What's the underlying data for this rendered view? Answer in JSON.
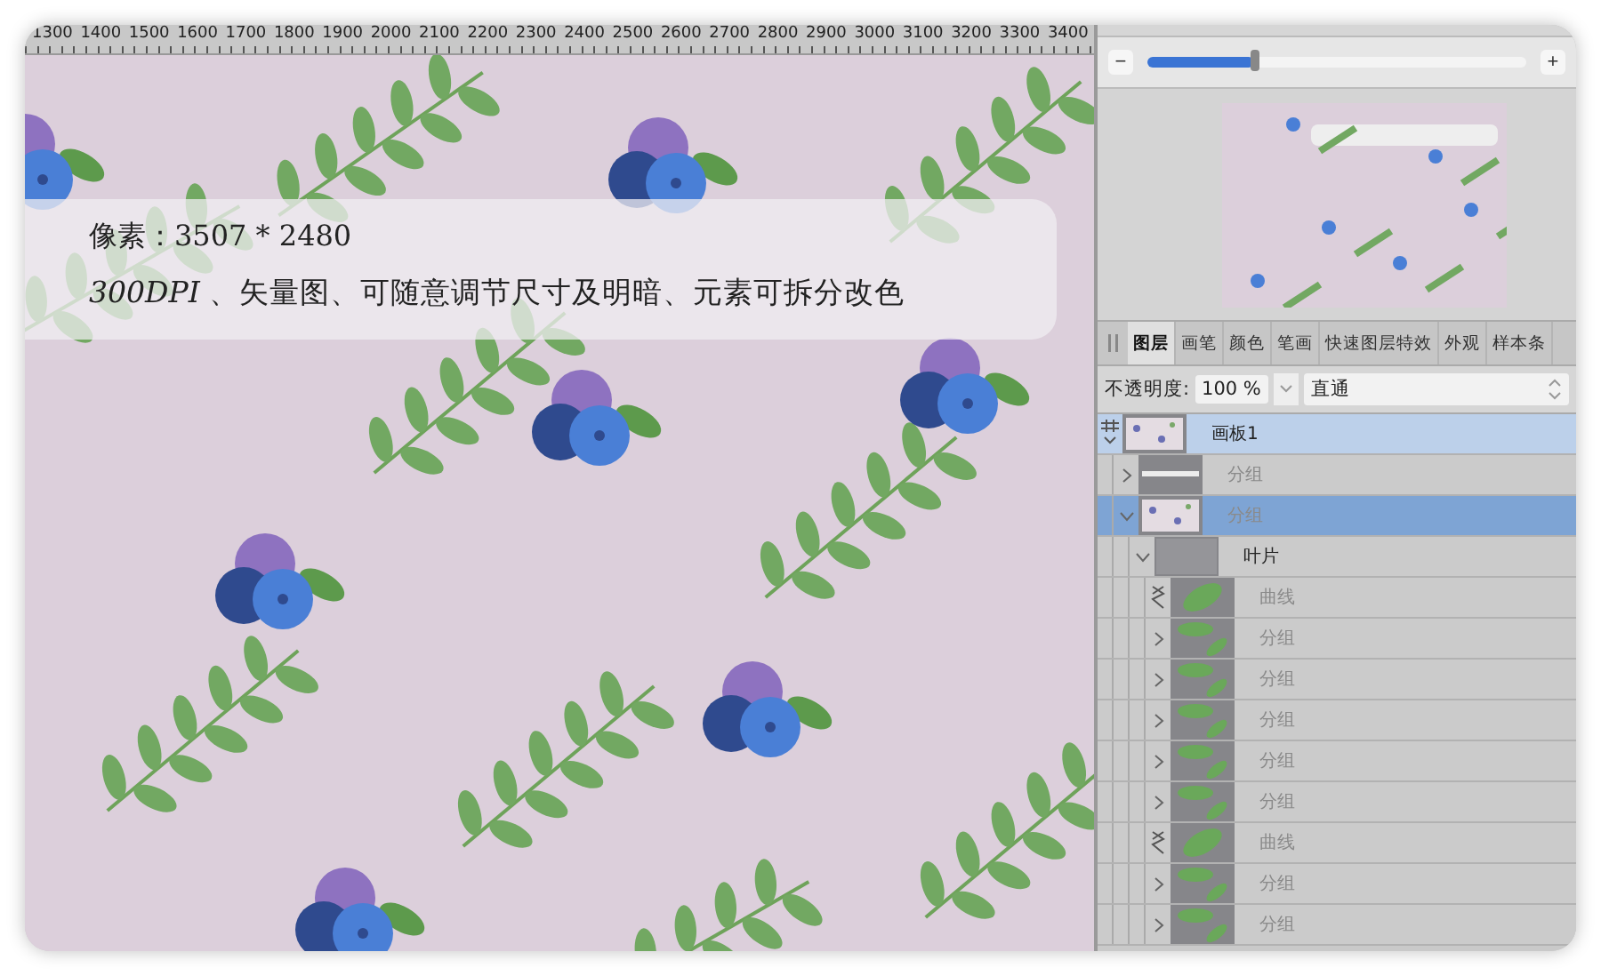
{
  "ruler": {
    "labels": [
      "1300",
      "1400",
      "1500",
      "1600",
      "1700",
      "1800",
      "1900",
      "2000",
      "2100",
      "2200",
      "2300",
      "2400",
      "2500",
      "2600",
      "2700",
      "2800",
      "2900",
      "3000",
      "3100",
      "3200",
      "3300",
      "3400"
    ]
  },
  "canvas": {
    "overlay_lines": [
      "像素：3507 * 2480",
      "*300DPI* 、矢量图、可随意调节尺寸及明暗、元素可拆分改色"
    ]
  },
  "zoom": {
    "minus": "−",
    "plus": "+",
    "level": 0.28
  },
  "tabs": [
    {
      "label": "图层",
      "selected": true
    },
    {
      "label": "画笔",
      "selected": false
    },
    {
      "label": "颜色",
      "selected": false
    },
    {
      "label": "笔画",
      "selected": false
    },
    {
      "label": "快速图层特效",
      "selected": false
    },
    {
      "label": "外观",
      "selected": false
    },
    {
      "label": "样本条",
      "selected": false
    }
  ],
  "opacity": {
    "label": "不透明度:",
    "value": "100 %",
    "blend_mode": "直通"
  },
  "layers": [
    {
      "name": "画板1",
      "kind": "artboard",
      "thumbnail": {
        "kind": "pattern"
      },
      "selected": true,
      "expanded": true,
      "hidden": false,
      "children": [
        {
          "name": "分组",
          "kind": "group",
          "thumbnail": {
            "kind": "line"
          },
          "selected": false,
          "expanded": false,
          "hidden": true
        },
        {
          "name": "分组",
          "kind": "group",
          "thumbnail": {
            "kind": "pattern"
          },
          "selected": true,
          "expanded": true,
          "hidden": true,
          "children": [
            {
              "name": "叶片",
              "kind": "group",
              "thumbnail": {
                "kind": "blank"
              },
              "selected": false,
              "expanded": true,
              "hidden": false,
              "children": [
                {
                  "name": "曲线",
                  "kind": "curve",
                  "thumbnail": {
                    "kind": "leaf"
                  },
                  "selected": false,
                  "hidden": true
                },
                {
                  "name": "分组",
                  "kind": "group",
                  "thumbnail": {
                    "kind": "leaves"
                  },
                  "selected": false,
                  "expanded": false,
                  "hidden": true
                },
                {
                  "name": "分组",
                  "kind": "group",
                  "thumbnail": {
                    "kind": "leaves"
                  },
                  "selected": false,
                  "expanded": false,
                  "hidden": true
                },
                {
                  "name": "分组",
                  "kind": "group",
                  "thumbnail": {
                    "kind": "leaves"
                  },
                  "selected": false,
                  "expanded": false,
                  "hidden": true
                },
                {
                  "name": "分组",
                  "kind": "group",
                  "thumbnail": {
                    "kind": "leaves"
                  },
                  "selected": false,
                  "expanded": false,
                  "hidden": true
                },
                {
                  "name": "分组",
                  "kind": "group",
                  "thumbnail": {
                    "kind": "leaves"
                  },
                  "selected": false,
                  "expanded": false,
                  "hidden": true
                },
                {
                  "name": "曲线",
                  "kind": "curve",
                  "thumbnail": {
                    "kind": "leaf"
                  },
                  "selected": false,
                  "hidden": true
                },
                {
                  "name": "分组",
                  "kind": "group",
                  "thumbnail": {
                    "kind": "leaves"
                  },
                  "selected": false,
                  "expanded": false,
                  "hidden": true
                },
                {
                  "name": "分组",
                  "kind": "group",
                  "thumbnail": {
                    "kind": "leaves"
                  },
                  "selected": false,
                  "expanded": false,
                  "hidden": true
                }
              ]
            }
          ]
        }
      ]
    }
  ]
}
